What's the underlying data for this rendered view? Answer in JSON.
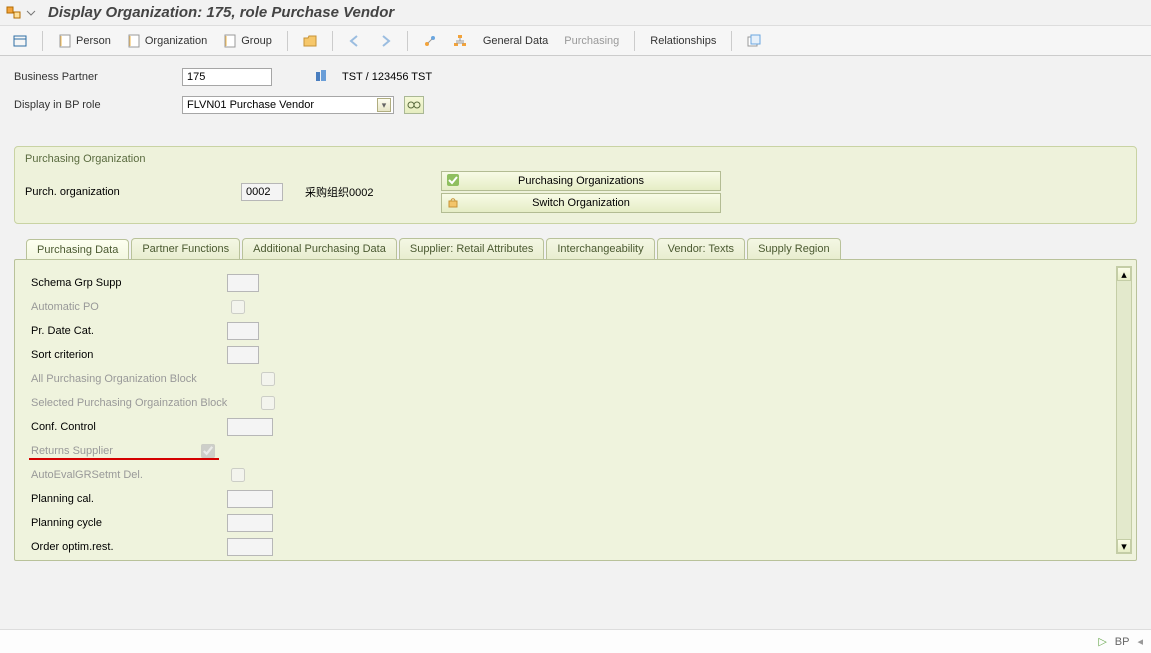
{
  "title": "Display Organization: 175, role Purchase Vendor",
  "toolbar": {
    "person": "Person",
    "organization": "Organization",
    "group": "Group",
    "general_data": "General Data",
    "purchasing": "Purchasing",
    "relationships": "Relationships"
  },
  "header": {
    "bp_label": "Business Partner",
    "bp_value": "175",
    "bp_desc": "TST / 123456 TST",
    "role_label": "Display in BP role",
    "role_value": "FLVN01 Purchase Vendor"
  },
  "purch_org_panel": {
    "title": "Purchasing Organization",
    "label": "Purch. organization",
    "value": "0002",
    "desc": "采购组织0002",
    "btn1": "Purchasing Organizations",
    "btn2": "Switch Organization"
  },
  "tabs": [
    "Purchasing Data",
    "Partner Functions",
    "Additional Purchasing Data",
    "Supplier: Retail Attributes",
    "Interchangeability",
    "Vendor: Texts",
    "Supply Region"
  ],
  "form": {
    "schema_grp": "Schema Grp Supp",
    "auto_po": "Automatic PO",
    "pr_date": "Pr. Date Cat.",
    "sort": "Sort criterion",
    "all_block": "All Purchasing Organization Block",
    "sel_block": "Selected Purchasing Orgainzation Block",
    "conf_ctrl": "Conf. Control",
    "returns": "Returns Supplier",
    "autoeval": "AutoEvalGRSetmt Del.",
    "plan_cal": "Planning cal.",
    "plan_cycle": "Planning cycle",
    "order_optim": "Order optim.rest."
  },
  "footer": {
    "bp": "BP"
  }
}
